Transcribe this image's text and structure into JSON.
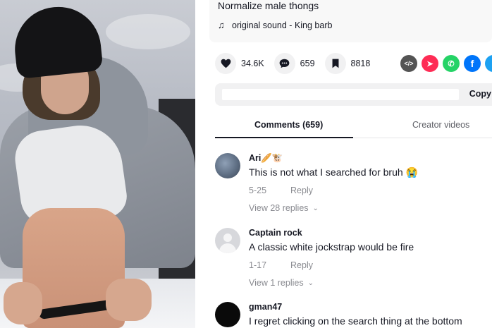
{
  "post": {
    "caption": "Normalize male thongs",
    "sound_icon": "music-note-icon",
    "sound": "original sound - King barb"
  },
  "actions": {
    "likes": "34.6K",
    "comments": "659",
    "saves": "8818"
  },
  "share_icons": [
    {
      "name": "embed-icon",
      "glyph": "</>",
      "color": "#545454"
    },
    {
      "name": "send-to-friends-icon",
      "glyph": "➤",
      "color": "#fe2c55"
    },
    {
      "name": "whatsapp-icon",
      "glyph": "✆",
      "color": "#25d366"
    },
    {
      "name": "facebook-icon",
      "glyph": "f",
      "color": "#0075fa"
    },
    {
      "name": "twitter-icon",
      "glyph": "t",
      "color": "#1da1f2"
    }
  ],
  "link_bar": {
    "copy_label": "Copy"
  },
  "tabs": {
    "comments_label": "Comments (659)",
    "creator_label": "Creator videos"
  },
  "comments": [
    {
      "user": "Ari🥖🐮",
      "text": "This is not what I searched for bruh 😭",
      "date": "5-25",
      "reply": "Reply",
      "replies": "View 28 replies"
    },
    {
      "user": "Captain rock",
      "text": "A classic white jockstrap would be fire",
      "date": "1-17",
      "reply": "Reply",
      "replies": "View 1 replies"
    },
    {
      "user": "gman47",
      "text": "I regret clicking on the search thing at the bottom"
    }
  ]
}
